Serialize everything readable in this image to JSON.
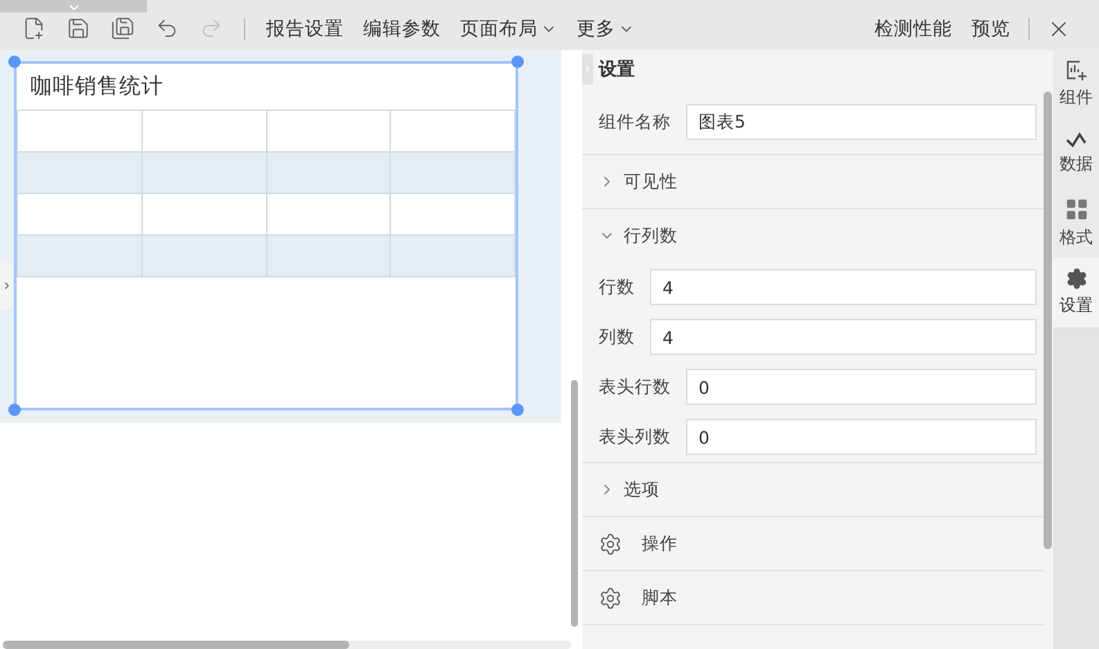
{
  "toolbar": {
    "tools": [
      {
        "kind": "new",
        "disabled": false
      },
      {
        "kind": "save",
        "disabled": false
      },
      {
        "kind": "save-as",
        "disabled": false
      },
      {
        "kind": "undo",
        "disabled": false
      },
      {
        "kind": "redo",
        "disabled": true
      }
    ],
    "menus": [
      {
        "label": "报告设置",
        "dropdown": false
      },
      {
        "label": "编辑参数",
        "dropdown": false
      },
      {
        "label": "页面布局",
        "dropdown": true
      },
      {
        "label": "更多",
        "dropdown": true
      }
    ],
    "right_actions": [
      "检测性能",
      "预览"
    ]
  },
  "canvas": {
    "component": {
      "title": "咖啡销售统计",
      "table": {
        "rows": [
          {
            "shaded": false
          },
          {
            "shaded": true
          },
          {
            "shaded": false
          },
          {
            "shaded": true
          }
        ]
      }
    }
  },
  "settings_panel": {
    "title": "设置",
    "name_field": {
      "label": "组件名称",
      "value": "图表5"
    },
    "sections": [
      {
        "kind": "collapsible",
        "label": "可见性",
        "expanded": false
      },
      {
        "kind": "collapsible",
        "label": "行列数",
        "expanded": true,
        "fields": [
          {
            "label": "行数",
            "value": "4"
          },
          {
            "label": "列数",
            "value": "4"
          },
          {
            "label": "表头行数",
            "value": "0"
          },
          {
            "label": "表头列数",
            "value": "0"
          }
        ]
      },
      {
        "kind": "collapsible",
        "label": "选项",
        "expanded": false
      },
      {
        "kind": "action",
        "label": "操作"
      },
      {
        "kind": "action",
        "label": "脚本"
      }
    ]
  },
  "side_tabs": [
    {
      "kind": "component",
      "label": "组件",
      "selected": false
    },
    {
      "kind": "data",
      "label": "数据",
      "selected": false
    },
    {
      "kind": "format",
      "label": "格式",
      "selected": false
    },
    {
      "kind": "settings",
      "label": "设置",
      "selected": true
    }
  ]
}
